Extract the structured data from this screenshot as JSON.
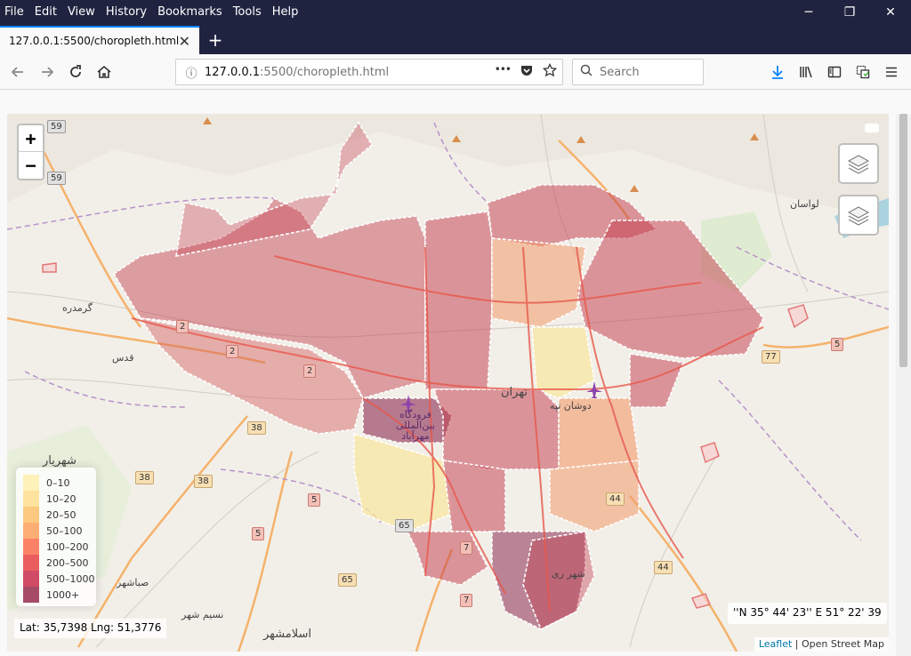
{
  "menu": {
    "items": [
      {
        "label": "File"
      },
      {
        "label": "Edit"
      },
      {
        "label": "View"
      },
      {
        "label": "History"
      },
      {
        "label": "Bookmarks"
      },
      {
        "label": "Tools"
      },
      {
        "label": "Help"
      }
    ]
  },
  "window": {
    "minimize": "─",
    "maximize": "❐",
    "close": "✕"
  },
  "tab": {
    "title": "127.0.0.1:5500/choropleth.html",
    "close": "✕",
    "new": "+"
  },
  "nav": {
    "url_host": "127.0.0.1",
    "url_rest": ":5500/choropleth.html",
    "search_placeholder": "Search",
    "url_menu": "•••"
  },
  "map": {
    "zoom_in": "+",
    "zoom_out": "−",
    "legend": [
      {
        "label": "0–10",
        "color": "#ffeda0"
      },
      {
        "label": "10–20",
        "color": "#fed976"
      },
      {
        "label": "20–50",
        "color": "#feb24c"
      },
      {
        "label": "50–100",
        "color": "#fd8d3c"
      },
      {
        "label": "100–200",
        "color": "#fc4e2a"
      },
      {
        "label": "200–500",
        "color": "#e31a1c"
      },
      {
        "label": "500–1000",
        "color": "#bd0026"
      },
      {
        "label": "1000+",
        "color": "#800026"
      }
    ],
    "coords": "Lat: 35,7398 Lng: 51,3776",
    "dms": "''N 35° 44' 23'' E 51° 22' 39",
    "attribution_link": "Leaflet",
    "attribution_rest": " | Open Street Map",
    "places": {
      "tehran": "تهران",
      "lavasan": "لواسان",
      "shahriar": "شهریار",
      "shahre_rey": "شهر ری",
      "eslamshahr": "اسلامشهر",
      "qods": "قدس",
      "garmdareh": "گرمدره",
      "sabashahr": "صباشهر",
      "nasimshahr": "نسیم شهر",
      "airport": "فرودگاه بین‌المللی مهرآباد",
      "doshan_tappeh": "دوشان تپه"
    },
    "road_shields": [
      "59",
      "59",
      "2",
      "2",
      "2",
      "38",
      "38",
      "38",
      "5",
      "5",
      "65",
      "7",
      "7",
      "44",
      "44",
      "65",
      "77",
      "5"
    ]
  }
}
